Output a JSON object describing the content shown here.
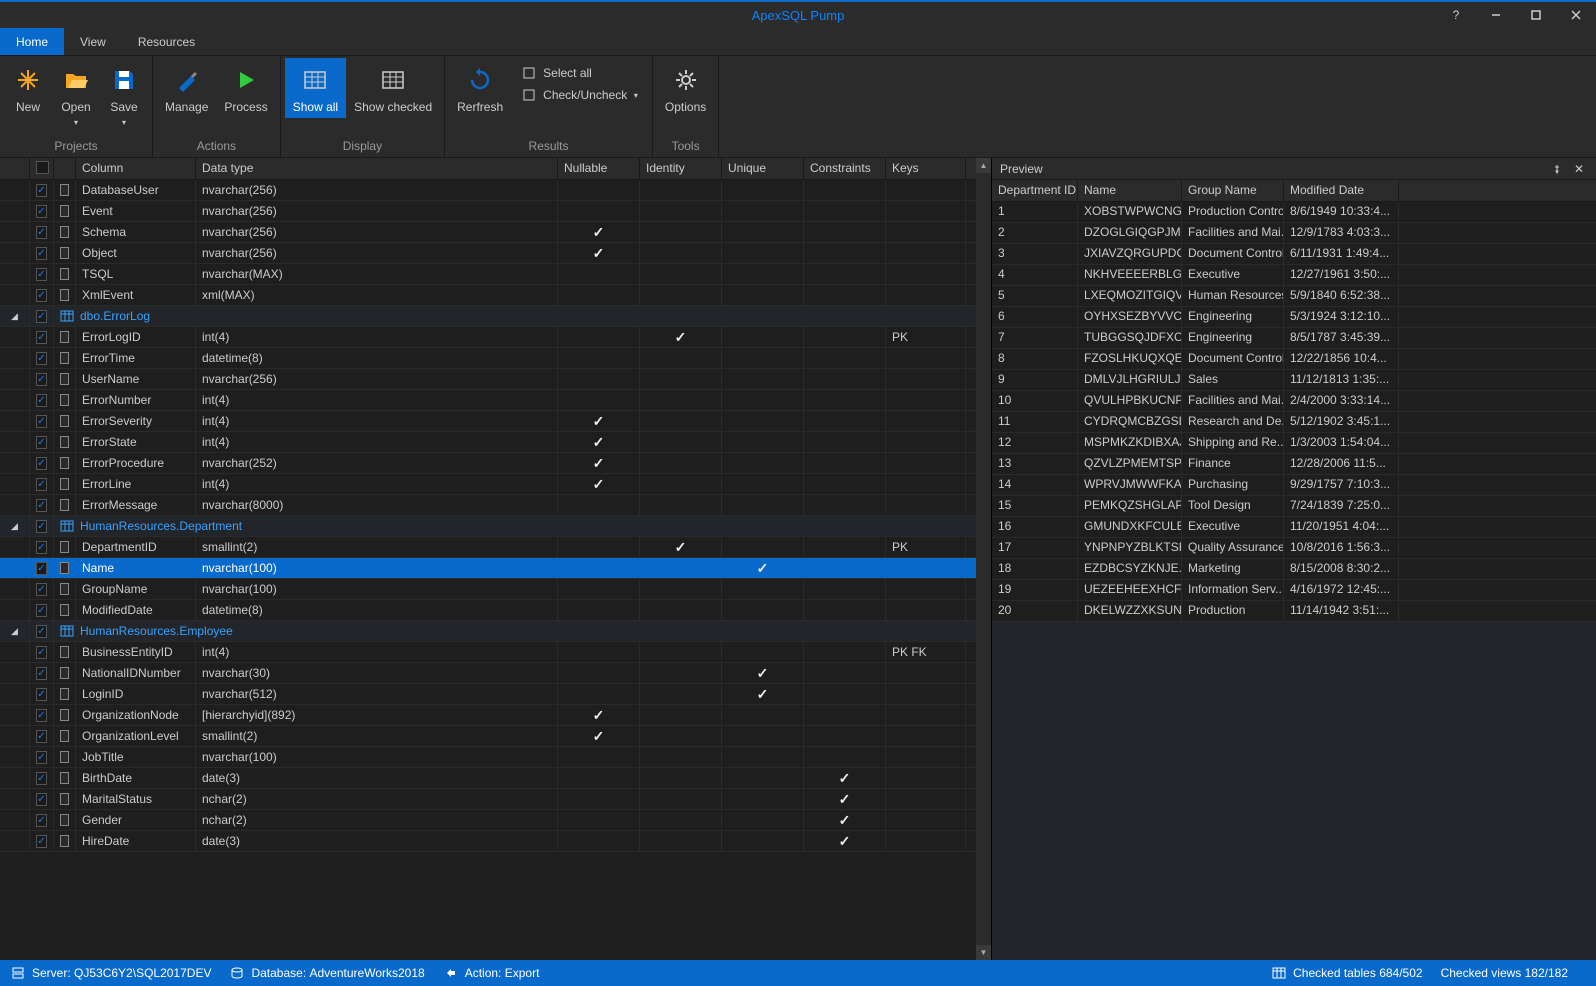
{
  "titlebar": {
    "title": "ApexSQL Pump"
  },
  "tabs": [
    {
      "label": "Home",
      "active": true
    },
    {
      "label": "View",
      "active": false
    },
    {
      "label": "Resources",
      "active": false
    }
  ],
  "ribbon": {
    "groups": [
      {
        "label": "Projects",
        "items": [
          {
            "id": "new",
            "label": "New",
            "icon": "new-icon"
          },
          {
            "id": "open",
            "label": "Open",
            "icon": "open-icon",
            "dropdown": true
          },
          {
            "id": "save",
            "label": "Save",
            "icon": "save-icon",
            "dropdown": true
          }
        ]
      },
      {
        "label": "Actions",
        "items": [
          {
            "id": "manage",
            "label": "Manage",
            "icon": "manage-icon"
          },
          {
            "id": "process",
            "label": "Process",
            "icon": "process-icon"
          }
        ]
      },
      {
        "label": "Display",
        "items": [
          {
            "id": "showall",
            "label": "Show all",
            "icon": "grid-icon",
            "active": true
          },
          {
            "id": "showchecked",
            "label": "Show checked",
            "icon": "grid-icon"
          }
        ]
      },
      {
        "label": "Results",
        "items": [
          {
            "id": "refresh",
            "label": "Rerfresh",
            "icon": "refresh-icon"
          }
        ],
        "small": [
          {
            "id": "selectall",
            "label": "Select all",
            "icon": "select-all-icon"
          },
          {
            "id": "checkuncheck",
            "label": "Check/Uncheck",
            "icon": "check-icon",
            "dropdown": true
          }
        ]
      },
      {
        "label": "Tools",
        "items": [
          {
            "id": "options",
            "label": "Options",
            "icon": "gear-icon"
          }
        ]
      }
    ]
  },
  "grid": {
    "headers": {
      "column": "Column",
      "datatype": "Data type",
      "nullable": "Nullable",
      "identity": "Identity",
      "unique": "Unique",
      "constraints": "Constraints",
      "keys": "Keys"
    },
    "rows": [
      {
        "t": "col",
        "name": "DatabaseUser",
        "dt": "nvarchar(256)",
        "n": false,
        "i": false,
        "u": false,
        "c": false,
        "k": ""
      },
      {
        "t": "col",
        "name": "Event",
        "dt": "nvarchar(256)",
        "n": false,
        "i": false,
        "u": false,
        "c": false,
        "k": ""
      },
      {
        "t": "col",
        "name": "Schema",
        "dt": "nvarchar(256)",
        "n": true,
        "i": false,
        "u": false,
        "c": false,
        "k": ""
      },
      {
        "t": "col",
        "name": "Object",
        "dt": "nvarchar(256)",
        "n": true,
        "i": false,
        "u": false,
        "c": false,
        "k": ""
      },
      {
        "t": "col",
        "name": "TSQL",
        "dt": "nvarchar(MAX)",
        "n": false,
        "i": false,
        "u": false,
        "c": false,
        "k": ""
      },
      {
        "t": "col",
        "name": "XmlEvent",
        "dt": "xml(MAX)",
        "n": false,
        "i": false,
        "u": false,
        "c": false,
        "k": ""
      },
      {
        "t": "group",
        "name": "dbo.ErrorLog"
      },
      {
        "t": "col",
        "name": "ErrorLogID",
        "dt": "int(4)",
        "n": false,
        "i": true,
        "u": false,
        "c": false,
        "k": "PK"
      },
      {
        "t": "col",
        "name": "ErrorTime",
        "dt": "datetime(8)",
        "n": false,
        "i": false,
        "u": false,
        "c": false,
        "k": ""
      },
      {
        "t": "col",
        "name": "UserName",
        "dt": "nvarchar(256)",
        "n": false,
        "i": false,
        "u": false,
        "c": false,
        "k": ""
      },
      {
        "t": "col",
        "name": "ErrorNumber",
        "dt": "int(4)",
        "n": false,
        "i": false,
        "u": false,
        "c": false,
        "k": ""
      },
      {
        "t": "col",
        "name": "ErrorSeverity",
        "dt": "int(4)",
        "n": true,
        "i": false,
        "u": false,
        "c": false,
        "k": ""
      },
      {
        "t": "col",
        "name": "ErrorState",
        "dt": "int(4)",
        "n": true,
        "i": false,
        "u": false,
        "c": false,
        "k": ""
      },
      {
        "t": "col",
        "name": "ErrorProcedure",
        "dt": "nvarchar(252)",
        "n": true,
        "i": false,
        "u": false,
        "c": false,
        "k": ""
      },
      {
        "t": "col",
        "name": "ErrorLine",
        "dt": "int(4)",
        "n": true,
        "i": false,
        "u": false,
        "c": false,
        "k": ""
      },
      {
        "t": "col",
        "name": "ErrorMessage",
        "dt": "nvarchar(8000)",
        "n": false,
        "i": false,
        "u": false,
        "c": false,
        "k": ""
      },
      {
        "t": "group",
        "name": "HumanResources.Department"
      },
      {
        "t": "col",
        "name": "DepartmentID",
        "dt": "smallint(2)",
        "n": false,
        "i": true,
        "u": false,
        "c": false,
        "k": "PK"
      },
      {
        "t": "col",
        "name": "Name",
        "dt": "nvarchar(100)",
        "n": false,
        "i": false,
        "u": true,
        "c": false,
        "k": "",
        "selected": true
      },
      {
        "t": "col",
        "name": "GroupName",
        "dt": "nvarchar(100)",
        "n": false,
        "i": false,
        "u": false,
        "c": false,
        "k": ""
      },
      {
        "t": "col",
        "name": "ModifiedDate",
        "dt": "datetime(8)",
        "n": false,
        "i": false,
        "u": false,
        "c": false,
        "k": ""
      },
      {
        "t": "group",
        "name": "HumanResources.Employee"
      },
      {
        "t": "col",
        "name": "BusinessEntityID",
        "dt": "int(4)",
        "n": false,
        "i": false,
        "u": false,
        "c": false,
        "k": "PK FK"
      },
      {
        "t": "col",
        "name": "NationalIDNumber",
        "dt": "nvarchar(30)",
        "n": false,
        "i": false,
        "u": true,
        "c": false,
        "k": ""
      },
      {
        "t": "col",
        "name": "LoginID",
        "dt": "nvarchar(512)",
        "n": false,
        "i": false,
        "u": true,
        "c": false,
        "k": ""
      },
      {
        "t": "col",
        "name": "OrganizationNode",
        "dt": "[hierarchyid](892)",
        "n": true,
        "i": false,
        "u": false,
        "c": false,
        "k": ""
      },
      {
        "t": "col",
        "name": "OrganizationLevel",
        "dt": "smallint(2)",
        "n": true,
        "i": false,
        "u": false,
        "c": false,
        "k": ""
      },
      {
        "t": "col",
        "name": "JobTitle",
        "dt": "nvarchar(100)",
        "n": false,
        "i": false,
        "u": false,
        "c": false,
        "k": ""
      },
      {
        "t": "col",
        "name": "BirthDate",
        "dt": "date(3)",
        "n": false,
        "i": false,
        "u": false,
        "c": true,
        "k": ""
      },
      {
        "t": "col",
        "name": "MaritalStatus",
        "dt": "nchar(2)",
        "n": false,
        "i": false,
        "u": false,
        "c": true,
        "k": ""
      },
      {
        "t": "col",
        "name": "Gender",
        "dt": "nchar(2)",
        "n": false,
        "i": false,
        "u": false,
        "c": true,
        "k": ""
      },
      {
        "t": "col",
        "name": "HireDate",
        "dt": "date(3)",
        "n": false,
        "i": false,
        "u": false,
        "c": true,
        "k": ""
      }
    ]
  },
  "preview": {
    "title": "Preview",
    "headers": {
      "id": "Department ID",
      "name": "Name",
      "group": "Group Name",
      "date": "Modified Date"
    },
    "rows": [
      {
        "id": "1",
        "name": "XOBSTWPWCNG...",
        "group": "Production Control",
        "date": "8/6/1949 10:33:4..."
      },
      {
        "id": "2",
        "name": "DZOGLGIQGPJMS...",
        "group": "Facilities and Mai...",
        "date": "12/9/1783 4:03:3..."
      },
      {
        "id": "3",
        "name": "JXIAVZQRGUPDO...",
        "group": "Document Control",
        "date": "6/11/1931 1:49:4..."
      },
      {
        "id": "4",
        "name": "NKHVEEEERBLGL...",
        "group": "Executive",
        "date": "12/27/1961 3:50:..."
      },
      {
        "id": "5",
        "name": "LXEQMOZITGIQV...",
        "group": "Human Resources",
        "date": "5/9/1840 6:52:38..."
      },
      {
        "id": "6",
        "name": "OYHXSEZBYVVC...",
        "group": "Engineering",
        "date": "5/3/1924 3:12:10..."
      },
      {
        "id": "7",
        "name": "TUBGGSQJDFXC...",
        "group": "Engineering",
        "date": "8/5/1787 3:45:39..."
      },
      {
        "id": "8",
        "name": "FZOSLHKUQXQE...",
        "group": "Document Control",
        "date": "12/22/1856 10:4..."
      },
      {
        "id": "9",
        "name": "DMLVJLHGRIULJZ...",
        "group": "Sales",
        "date": "11/12/1813 1:35:..."
      },
      {
        "id": "10",
        "name": "QVULHPBKUCNP...",
        "group": "Facilities and Mai...",
        "date": "2/4/2000 3:33:14..."
      },
      {
        "id": "11",
        "name": "CYDRQMCBZGSL...",
        "group": "Research and De...",
        "date": "5/12/1902 3:45:1..."
      },
      {
        "id": "12",
        "name": "MSPMKZKDIBXAJ...",
        "group": "Shipping and Re...",
        "date": "1/3/2003 1:54:04..."
      },
      {
        "id": "13",
        "name": "QZVLZPMEMTSP...",
        "group": "Finance",
        "date": "12/28/2006 11:5..."
      },
      {
        "id": "14",
        "name": "WPRVJMWWFKA...",
        "group": "Purchasing",
        "date": "9/29/1757 7:10:3..."
      },
      {
        "id": "15",
        "name": "PEMKQZSHGLAP...",
        "group": "Tool Design",
        "date": "7/24/1839 7:25:0..."
      },
      {
        "id": "16",
        "name": "GMUNDXKFCULB...",
        "group": "Executive",
        "date": "11/20/1951 4:04:..."
      },
      {
        "id": "17",
        "name": "YNPNPYZBLKTSR...",
        "group": "Quality Assurance",
        "date": "10/8/2016 1:56:3..."
      },
      {
        "id": "18",
        "name": "EZDBCSYZKNJE...",
        "group": "Marketing",
        "date": "8/15/2008 8:30:2..."
      },
      {
        "id": "19",
        "name": "UEZEEHEEXHCFX...",
        "group": "Information Serv...",
        "date": "4/16/1972 12:45:..."
      },
      {
        "id": "20",
        "name": "DKELWZZXKSUN...",
        "group": "Production",
        "date": "11/14/1942 3:51:..."
      }
    ]
  },
  "statusbar": {
    "server_label": "Server:",
    "server": "QJ53C6Y2\\SQL2017DEV",
    "database_label": "Database:",
    "database": "AdventureWorks2018",
    "action_label": "Action:",
    "action": "Export",
    "tables": "Checked tables 684/502",
    "views": "Checked views 182/182"
  }
}
